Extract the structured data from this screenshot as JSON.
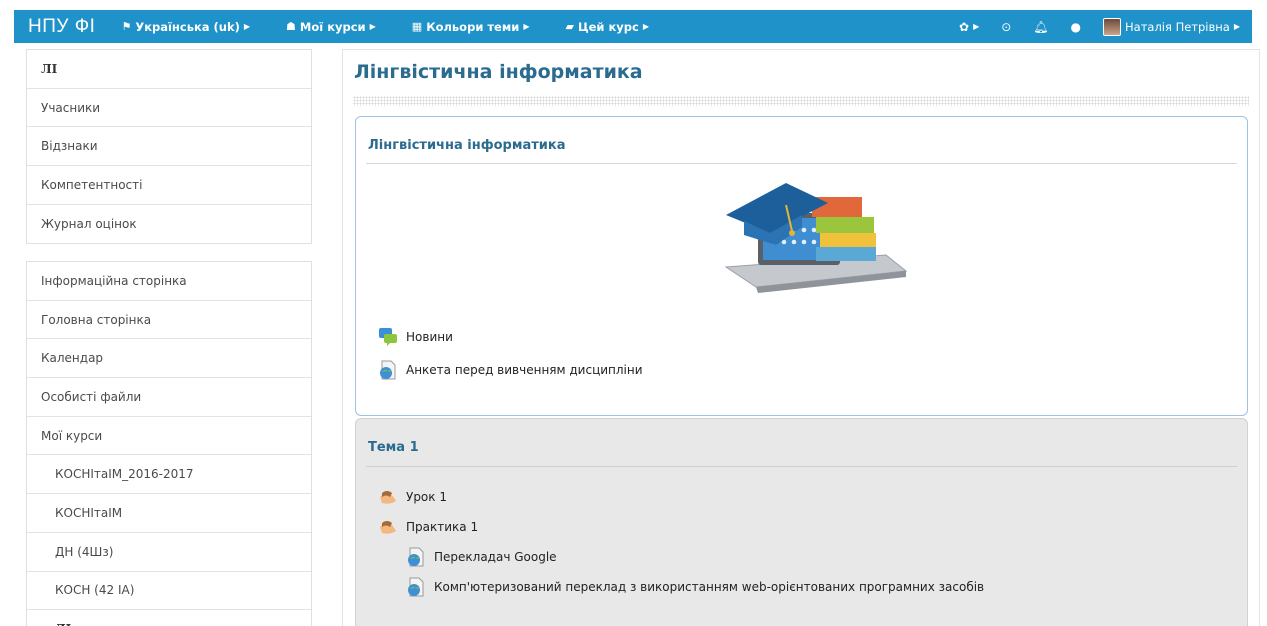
{
  "navbar": {
    "brand": "НПУ ФІ",
    "language": "Українська (uk)",
    "my_courses": "Мої курси",
    "theme_colors": "Кольори теми",
    "this_course": "Цей курс",
    "user_name": "Наталія Петрівна"
  },
  "sidebar": {
    "course_block": [
      {
        "label": "ЛІ"
      },
      {
        "label": "Учасники"
      },
      {
        "label": "Відзнаки"
      },
      {
        "label": "Компетентності"
      },
      {
        "label": "Журнал оцінок"
      }
    ],
    "nav_block": [
      {
        "label": "Інформаційна сторінка"
      },
      {
        "label": "Головна сторінка"
      },
      {
        "label": "Календар"
      },
      {
        "label": "Особисті файли"
      },
      {
        "label": "Мої курси"
      },
      {
        "label": "КОСНІтаІМ_2016-2017"
      },
      {
        "label": "КОСНІтаІМ"
      },
      {
        "label": "ДН (4Шз)"
      },
      {
        "label": "КОСН (42 ІА)"
      },
      {
        "label": "ЛІ"
      }
    ]
  },
  "main": {
    "page_title": "Лінгвістична інформатика",
    "section0": {
      "title": "Лінгвістична інформатика",
      "activities": [
        {
          "label": "Новини",
          "icon": "forum-icon"
        },
        {
          "label": "Анкета перед вивченням дисципліни",
          "icon": "url-icon"
        }
      ]
    },
    "section1": {
      "title": "Тема 1",
      "activities": [
        {
          "label": "Урок 1",
          "icon": "lesson-icon"
        },
        {
          "label": "Практика 1",
          "icon": "lesson-icon"
        },
        {
          "label": "Перекладач Google",
          "icon": "url-icon"
        },
        {
          "label": "Комп'ютеризований переклад з використанням web-орієнтованих програмних засобів",
          "icon": "url-icon"
        }
      ]
    }
  },
  "colors": {
    "navbar": "#1e92c9",
    "title": "#2a6b8f",
    "section_border": "#9fc2e6"
  }
}
